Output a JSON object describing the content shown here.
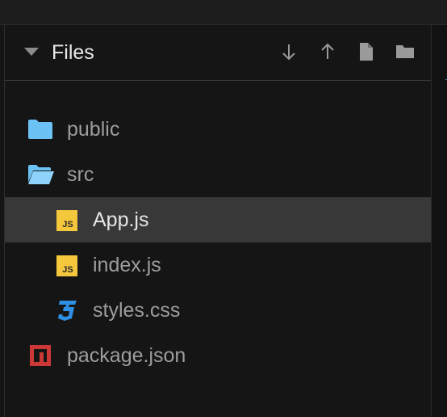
{
  "panel": {
    "title": "Files",
    "collapse_icon": "caret-down-icon",
    "actions": [
      {
        "name": "download",
        "icon": "arrow-down-icon"
      },
      {
        "name": "upload",
        "icon": "arrow-up-icon"
      },
      {
        "name": "new-file",
        "icon": "file-icon"
      },
      {
        "name": "new-folder",
        "icon": "folder-icon"
      }
    ]
  },
  "tree": [
    {
      "label": "public",
      "icon": "folder-closed-icon",
      "depth": 0,
      "selected": false
    },
    {
      "label": "src",
      "icon": "folder-open-icon",
      "depth": 0,
      "selected": false
    },
    {
      "label": "App.js",
      "icon": "js-file-icon",
      "depth": 1,
      "selected": true
    },
    {
      "label": "index.js",
      "icon": "js-file-icon",
      "depth": 1,
      "selected": false
    },
    {
      "label": "styles.css",
      "icon": "css3-file-icon",
      "depth": 1,
      "selected": false
    },
    {
      "label": "package.json",
      "icon": "npm-icon",
      "depth": 0,
      "selected": false
    }
  ],
  "colors": {
    "background": "#151515",
    "selected_row": "#383838",
    "folder": "#6cc2f5",
    "js_badge": "#f5c73c",
    "css_badge": "#2f8fe4",
    "npm_badge": "#cb3837",
    "text_muted": "#9d9d9d",
    "text_active": "#e6e6e6"
  }
}
